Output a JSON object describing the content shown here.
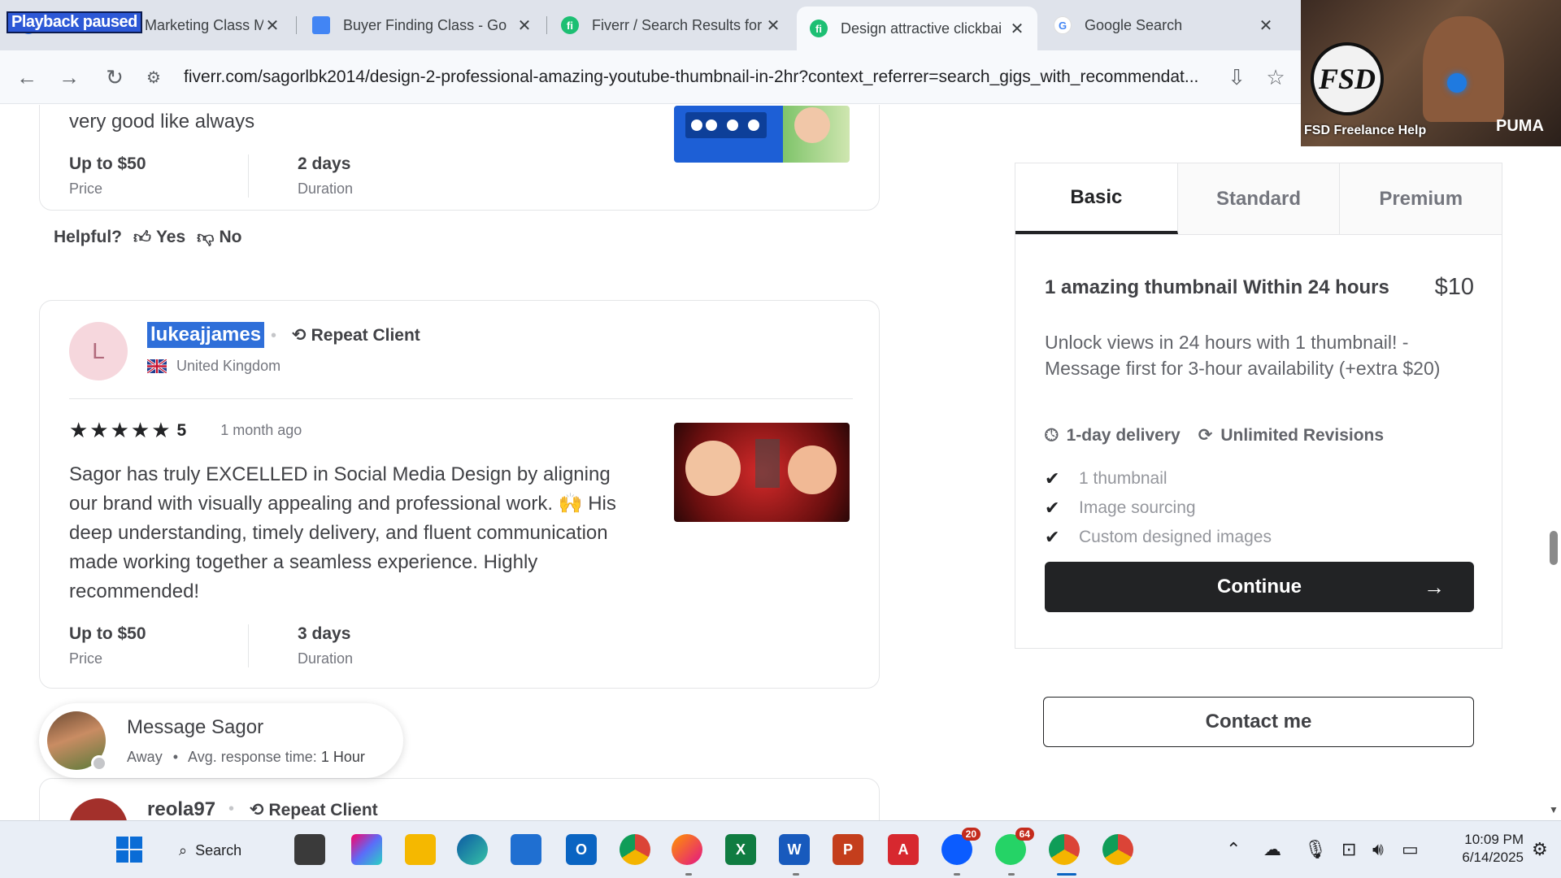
{
  "browser": {
    "playback_label": "Playback paused",
    "tabs": [
      {
        "title": "Buyer Finding Marketing Class M",
        "close": "✕",
        "favicon_color": "#4285f4"
      },
      {
        "title": "Buyer Finding Class - Go",
        "close": "✕",
        "favicon_color": "#4285f4"
      },
      {
        "title": "Fiverr / Search Results for",
        "close": "✕",
        "favicon_color": "#1dbf73"
      },
      {
        "title": "Design attractive clickbai",
        "close": "✕",
        "favicon_color": "#1dbf73"
      },
      {
        "title": "Google Search",
        "close": "✕",
        "favicon_color": "#4285f4"
      }
    ],
    "url": "fiverr.com/sagorlbk2014/design-2-professional-amazing-youtube-thumbnail-in-2hr?context_referrer=search_gigs_with_recommendat..."
  },
  "review1": {
    "text_tail": "very good like always",
    "price_value": "Up to $50",
    "price_label": "Price",
    "duration_value": "2 days",
    "duration_label": "Duration"
  },
  "helpful": {
    "label": "Helpful?",
    "yes": "Yes",
    "no": "No"
  },
  "review2": {
    "avatar_letter": "L",
    "username": "lukeajjames",
    "repeat_label": "Repeat Client",
    "country": "United Kingdom",
    "rating": "5",
    "rating_value": 5,
    "time_ago": "1 month ago",
    "text": "Sagor has truly EXCELLED in Social Media Design by aligning our brand with visually appealing and professional work. 🙌 His deep understanding, timely delivery, and fluent communication made working together a seamless experience. Highly recommended!",
    "price_value": "Up to $50",
    "price_label": "Price",
    "duration_value": "3 days",
    "duration_label": "Duration"
  },
  "review3": {
    "username": "reola97",
    "repeat_label": "Repeat Client"
  },
  "message": {
    "title": "Message Sagor",
    "status": "Away",
    "response_label": "Avg. response time:",
    "response_value": "1 Hour"
  },
  "pricing": {
    "tabs": [
      "Basic",
      "Standard",
      "Premium"
    ],
    "active_tab": "Basic",
    "title": "1 amazing thumbnail Within 24 hours",
    "price": "$10",
    "description": "Unlock views in 24 hours with 1 thumbnail! - Message first for 3-hour availability (+extra $20)",
    "delivery": "1-day delivery",
    "revisions": "Unlimited Revisions",
    "features": [
      "1 thumbnail",
      "Image sourcing",
      "Custom designed images"
    ],
    "continue_label": "Continue",
    "contact_label": "Contact me"
  },
  "webcam": {
    "logo_text": "FSD",
    "label": "FSD Freelance Help",
    "brand": "PUMA"
  },
  "taskbar": {
    "search_label": "Search",
    "zoom_badge": "20",
    "whatsapp_badge": "64",
    "time": "10:09 PM",
    "date": "6/14/2025"
  }
}
